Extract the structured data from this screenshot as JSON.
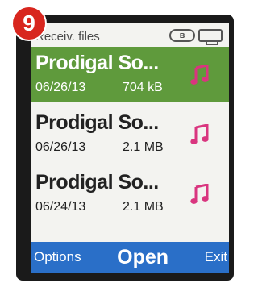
{
  "step_badge": "9",
  "header": {
    "title": "Receiv. files"
  },
  "files": [
    {
      "name": "Prodigal So...",
      "date": "06/26/13",
      "size": "704 kB",
      "selected": true
    },
    {
      "name": "Prodigal So...",
      "date": "06/26/13",
      "size": "2.1 MB",
      "selected": false
    },
    {
      "name": "Prodigal So...",
      "date": "06/24/13",
      "size": "2.1 MB",
      "selected": false
    }
  ],
  "softkeys": {
    "left": "Options",
    "center": "Open",
    "right": "Exit"
  },
  "colors": {
    "selection": "#5f9a3c",
    "softbar": "#2a6fc8",
    "music_icon": "#d9357f",
    "badge": "#d8261e"
  },
  "icons": [
    "bluetooth-icon",
    "usb-icon",
    "music-note-icon"
  ]
}
